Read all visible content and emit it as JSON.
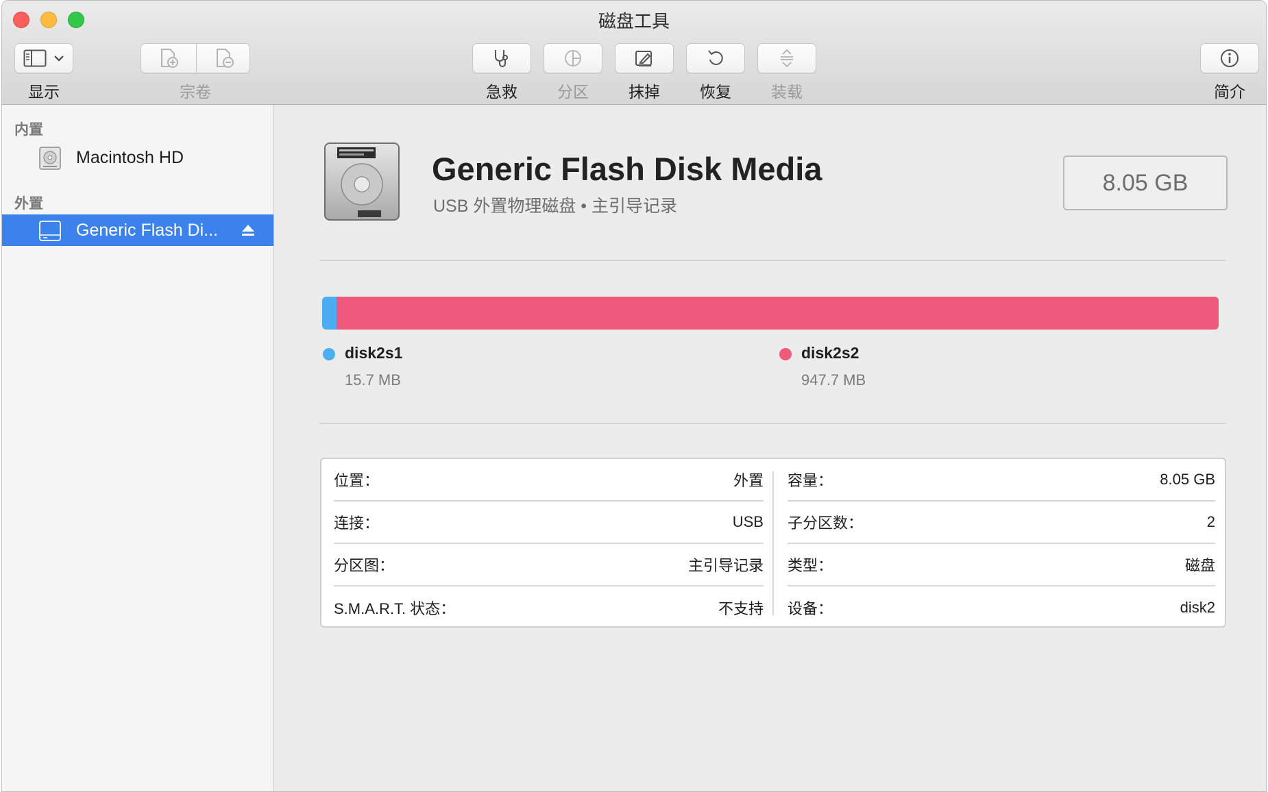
{
  "window": {
    "title": "磁盘工具"
  },
  "toolbar": {
    "view_label": "显示",
    "volume_label": "宗卷",
    "first_aid_label": "急救",
    "partition_label": "分区",
    "erase_label": "抹掉",
    "restore_label": "恢复",
    "mount_label": "装载",
    "info_label": "简介"
  },
  "sidebar": {
    "sections": [
      {
        "title": "内置",
        "items": [
          {
            "label": "Macintosh HD"
          }
        ]
      },
      {
        "title": "外置",
        "items": [
          {
            "label": "Generic Flash Di...",
            "selected": true
          }
        ]
      }
    ]
  },
  "disk": {
    "name": "Generic Flash Disk Media",
    "subtitle": "USB 外置物理磁盘 • 主引导记录",
    "capacity": "8.05 GB"
  },
  "partitions": [
    {
      "name": "disk2s1",
      "size": "15.7 MB",
      "color": "#4aaef0",
      "fraction": 0.0163
    },
    {
      "name": "disk2s2",
      "size": "947.7 MB",
      "color": "#ef5a7c",
      "fraction": 0.9837
    }
  ],
  "info": {
    "left": [
      {
        "key": "位置：",
        "value": "外置"
      },
      {
        "key": "连接：",
        "value": "USB"
      },
      {
        "key": "分区图：",
        "value": "主引导记录"
      },
      {
        "key": "S.M.A.R.T. 状态：",
        "value": "不支持"
      }
    ],
    "right": [
      {
        "key": "容量：",
        "value": "8.05 GB"
      },
      {
        "key": "子分区数：",
        "value": "2"
      },
      {
        "key": "类型：",
        "value": "磁盘"
      },
      {
        "key": "设备：",
        "value": "disk2"
      }
    ]
  },
  "colors": {
    "selection": "#3b82ed",
    "partition1": "#4aaef0",
    "partition2": "#ef5a7c"
  }
}
